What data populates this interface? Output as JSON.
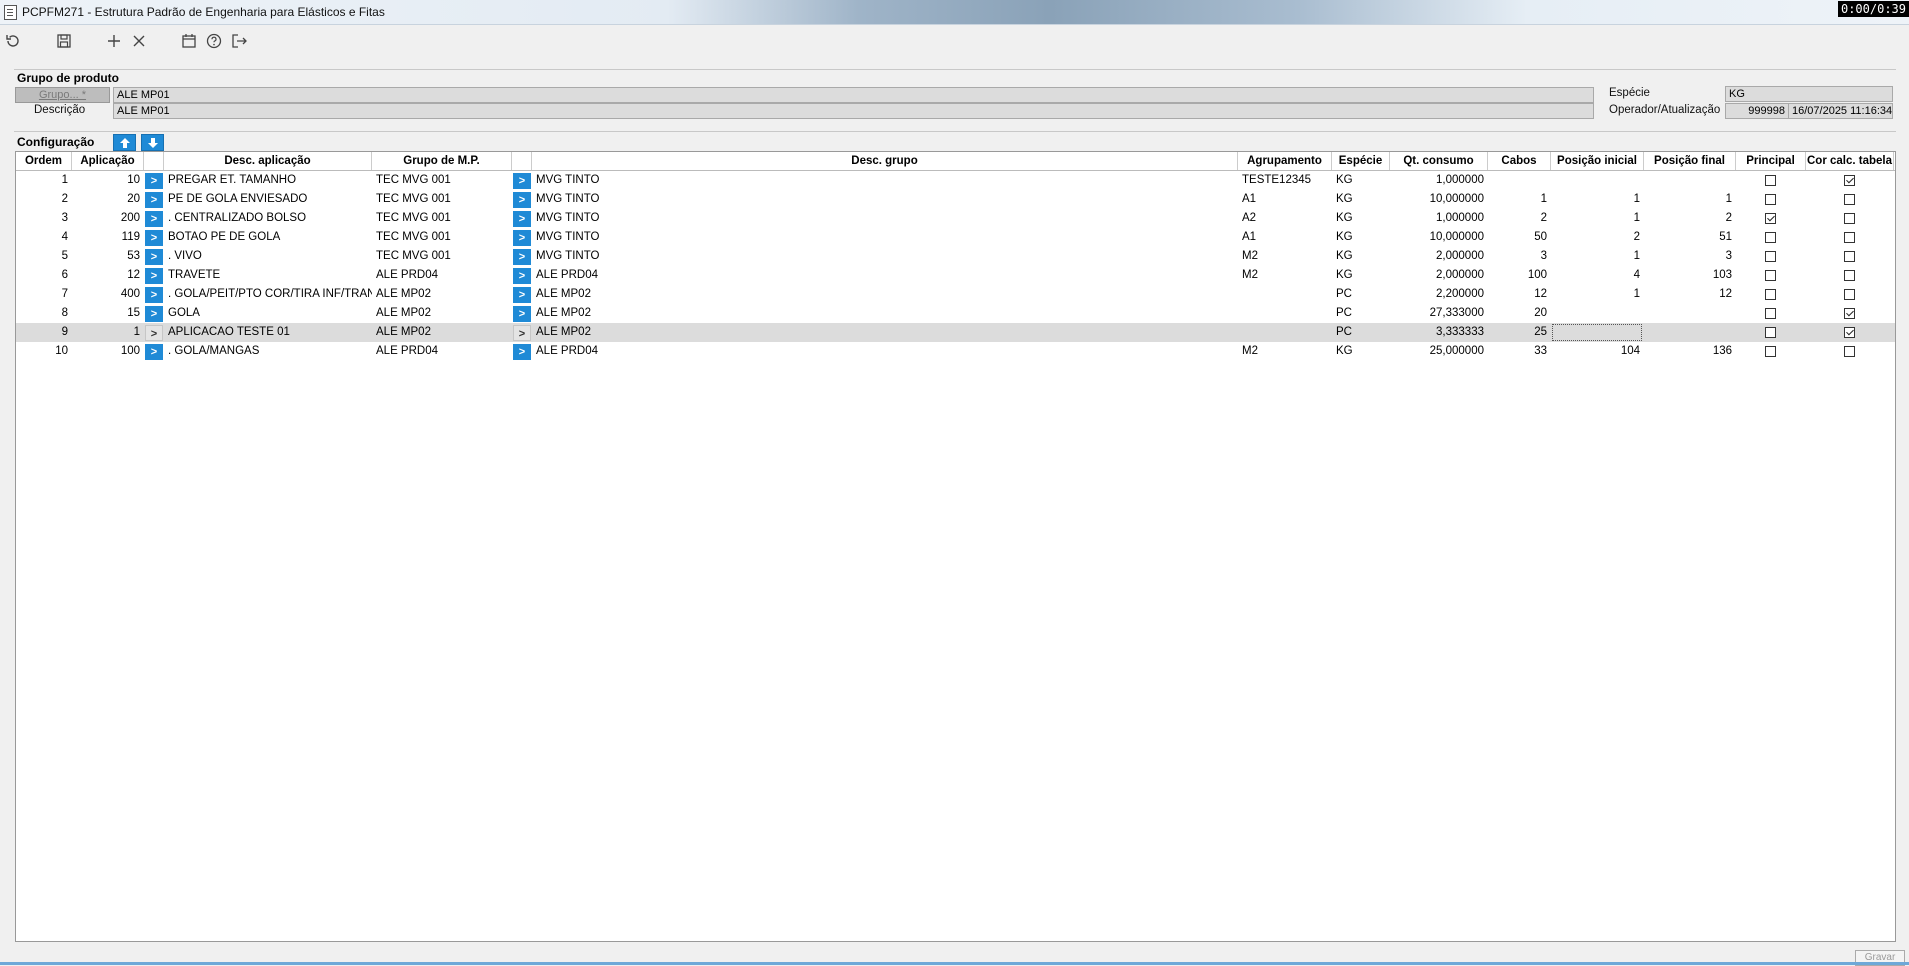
{
  "window": {
    "title": "PCPFM271 - Estrutura Padrão de Engenharia para Elásticos e Fitas",
    "timer": "0:00/0:39"
  },
  "toolbar": {
    "icons": [
      "refresh-icon",
      "save-icon",
      "add-icon",
      "delete-icon",
      "calendar-icon",
      "help-icon",
      "exit-icon"
    ]
  },
  "grupo_produto": {
    "section_title": "Grupo de produto",
    "grupo_button": "Grupo... *",
    "grupo_value": "ALE MP01",
    "descricao_label": "Descrição",
    "descricao_value": "ALE MP01",
    "especie_label": "Espécie",
    "especie_value": "KG",
    "operador_label": "Operador/Atualização",
    "operador_value": "999998",
    "atualizacao_value": "16/07/2025 11:16:34"
  },
  "configuracao": {
    "section_title": "Configuração",
    "columns": [
      "Ordem",
      "Aplicação",
      "Desc. aplicação",
      "Grupo de M.P.",
      "Desc. grupo",
      "Agrupamento",
      "Espécie",
      "Qt. consumo",
      "Cabos",
      "Posição inicial",
      "Posição final",
      "Principal",
      "Cor calc. tabela"
    ],
    "selected_row": 8,
    "rows": [
      {
        "ordem": "1",
        "aplicacao": "10",
        "desc_aplicacao": "PREGAR ET. TAMANHO",
        "grupo_mp": "TEC MVG 001",
        "desc_grupo": "MVG TINTO",
        "agrupamento": "TESTE12345",
        "especie": "KG",
        "qt_consumo": "1,000000",
        "cabos": "",
        "pos_inicial": "",
        "pos_final": "",
        "principal": false,
        "cor_calc": true
      },
      {
        "ordem": "2",
        "aplicacao": "20",
        "desc_aplicacao": "PE DE GOLA ENVIESADO",
        "grupo_mp": "TEC MVG 001",
        "desc_grupo": "MVG TINTO",
        "agrupamento": "A1",
        "especie": "KG",
        "qt_consumo": "10,000000",
        "cabos": "1",
        "pos_inicial": "1",
        "pos_final": "1",
        "principal": false,
        "cor_calc": false
      },
      {
        "ordem": "3",
        "aplicacao": "200",
        "desc_aplicacao": ". CENTRALIZADO BOLSO",
        "grupo_mp": "TEC MVG 001",
        "desc_grupo": "MVG TINTO",
        "agrupamento": "A2",
        "especie": "KG",
        "qt_consumo": "1,000000",
        "cabos": "2",
        "pos_inicial": "1",
        "pos_final": "2",
        "principal": true,
        "cor_calc": false
      },
      {
        "ordem": "4",
        "aplicacao": "119",
        "desc_aplicacao": "BOTAO PE DE GOLA",
        "grupo_mp": "TEC MVG 001",
        "desc_grupo": "MVG TINTO",
        "agrupamento": "A1",
        "especie": "KG",
        "qt_consumo": "10,000000",
        "cabos": "50",
        "pos_inicial": "2",
        "pos_final": "51",
        "principal": false,
        "cor_calc": false
      },
      {
        "ordem": "5",
        "aplicacao": "53",
        "desc_aplicacao": ". VIVO",
        "grupo_mp": "TEC MVG 001",
        "desc_grupo": "MVG TINTO",
        "agrupamento": "M2",
        "especie": "KG",
        "qt_consumo": "2,000000",
        "cabos": "3",
        "pos_inicial": "1",
        "pos_final": "3",
        "principal": false,
        "cor_calc": false
      },
      {
        "ordem": "6",
        "aplicacao": "12",
        "desc_aplicacao": "TRAVETE",
        "grupo_mp": "ALE PRD04",
        "desc_grupo": "ALE PRD04",
        "agrupamento": "M2",
        "especie": "KG",
        "qt_consumo": "2,000000",
        "cabos": "100",
        "pos_inicial": "4",
        "pos_final": "103",
        "principal": false,
        "cor_calc": false
      },
      {
        "ordem": "7",
        "aplicacao": "400",
        "desc_aplicacao": ". GOLA/PEIT/PTO COR/TIRA INF/TRANC PU",
        "grupo_mp": "ALE MP02",
        "desc_grupo": "ALE MP02",
        "agrupamento": "",
        "especie": "PC",
        "qt_consumo": "2,200000",
        "cabos": "12",
        "pos_inicial": "1",
        "pos_final": "12",
        "principal": false,
        "cor_calc": false
      },
      {
        "ordem": "8",
        "aplicacao": "15",
        "desc_aplicacao": "GOLA",
        "grupo_mp": "ALE MP02",
        "desc_grupo": "ALE MP02",
        "agrupamento": "",
        "especie": "PC",
        "qt_consumo": "27,333000",
        "cabos": "20",
        "pos_inicial": "",
        "pos_final": "",
        "principal": false,
        "cor_calc": true
      },
      {
        "ordem": "9",
        "aplicacao": "1",
        "desc_aplicacao": "APLICACAO TESTE 01",
        "grupo_mp": "ALE MP02",
        "desc_grupo": "ALE MP02",
        "agrupamento": "",
        "especie": "PC",
        "qt_consumo": "3,333333",
        "cabos": "25",
        "pos_inicial": "",
        "pos_final": "",
        "principal": false,
        "cor_calc": true
      },
      {
        "ordem": "10",
        "aplicacao": "100",
        "desc_aplicacao": ". GOLA/MANGAS",
        "grupo_mp": "ALE PRD04",
        "desc_grupo": "ALE PRD04",
        "agrupamento": "M2",
        "especie": "KG",
        "qt_consumo": "25,000000",
        "cabos": "33",
        "pos_inicial": "104",
        "pos_final": "136",
        "principal": false,
        "cor_calc": false
      }
    ]
  },
  "footer": {
    "corner_button": "Gravar"
  },
  "colors": {
    "accent": "#1f8ad6",
    "selected_row": "#dcdcdc"
  }
}
